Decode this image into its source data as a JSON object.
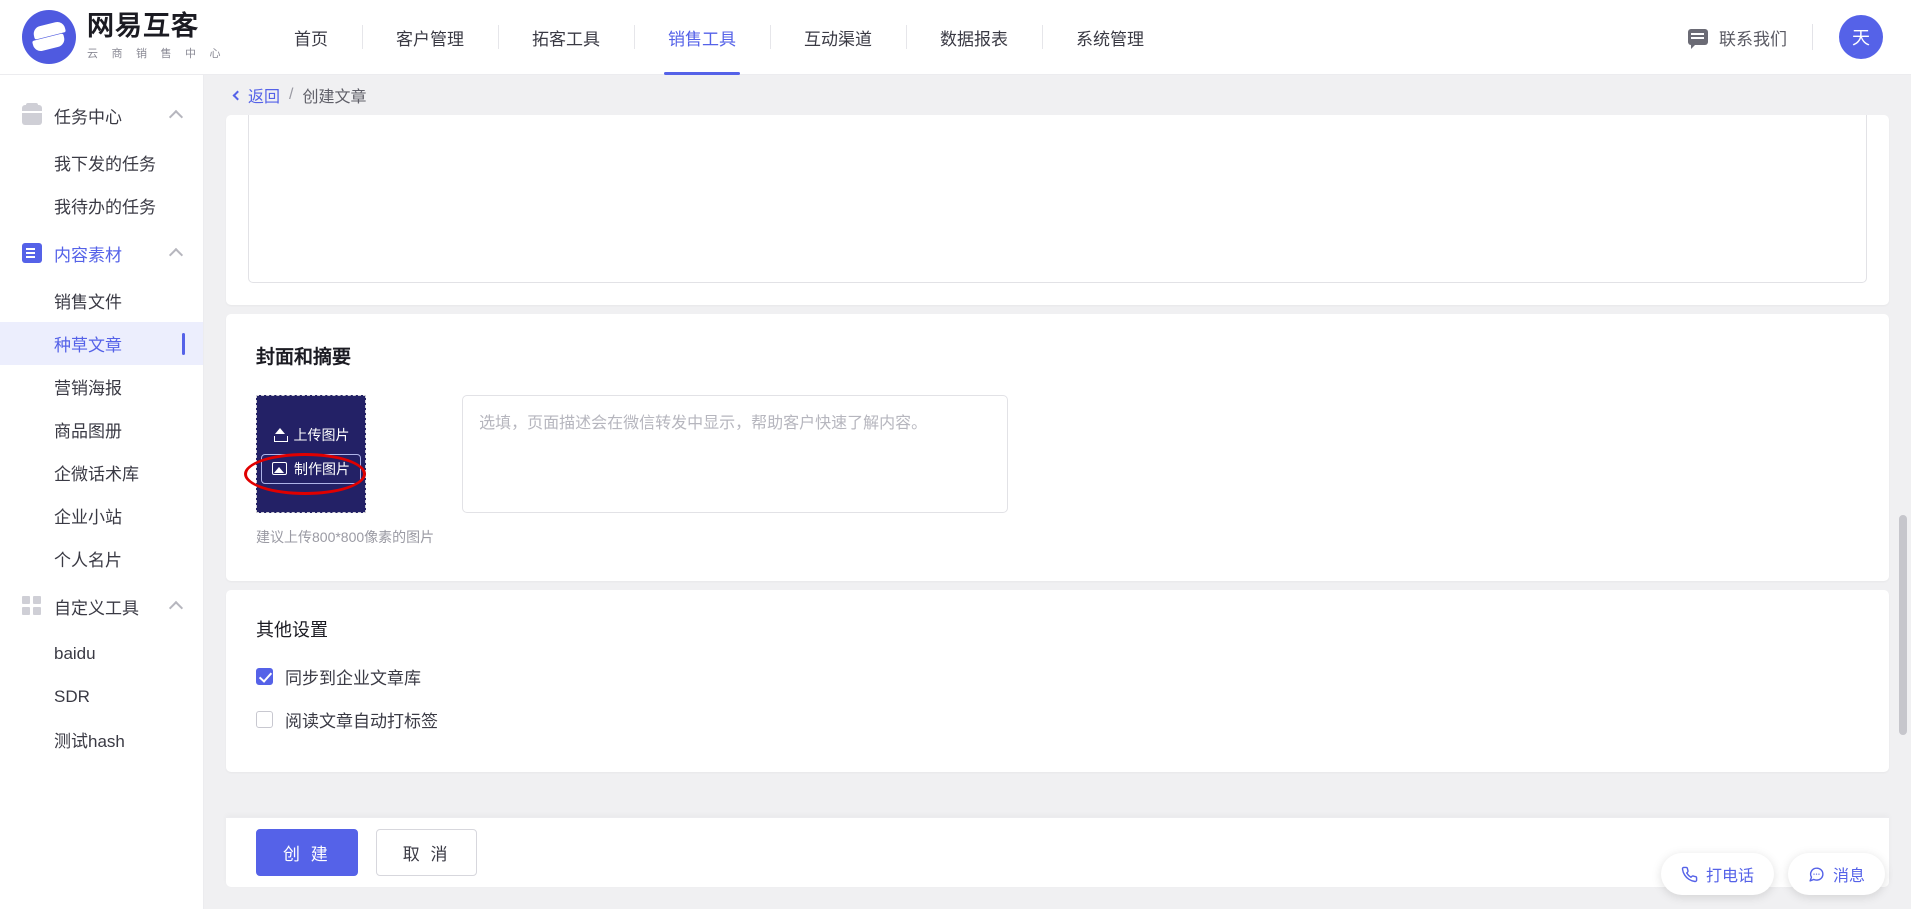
{
  "brand": {
    "name": "网易互客",
    "subtitle": "云 商 销 售 中 心",
    "logo_color": "#4f5ae0"
  },
  "topnav": {
    "items": [
      {
        "label": "首页",
        "active": false
      },
      {
        "label": "客户管理",
        "active": false
      },
      {
        "label": "拓客工具",
        "active": false
      },
      {
        "label": "销售工具",
        "active": true
      },
      {
        "label": "互动渠道",
        "active": false
      },
      {
        "label": "数据报表",
        "active": false
      },
      {
        "label": "系统管理",
        "active": false
      }
    ],
    "contact_label": "联系我们",
    "avatar_text": "天",
    "accent_color": "#5562e8"
  },
  "sidebar": {
    "groups": [
      {
        "label": "任务中心",
        "icon": "task-icon",
        "expanded": true,
        "items": [
          {
            "label": "我下发的任务",
            "active": false
          },
          {
            "label": "我待办的任务",
            "active": false
          }
        ]
      },
      {
        "label": "内容素材",
        "icon": "document-icon",
        "expanded": true,
        "accent": true,
        "items": [
          {
            "label": "销售文件",
            "active": false
          },
          {
            "label": "种草文章",
            "active": true
          },
          {
            "label": "营销海报",
            "active": false
          },
          {
            "label": "商品图册",
            "active": false
          },
          {
            "label": "企微话术库",
            "active": false
          },
          {
            "label": "企业小站",
            "active": false
          },
          {
            "label": "个人名片",
            "active": false
          }
        ]
      },
      {
        "label": "自定义工具",
        "icon": "grid-icon",
        "expanded": true,
        "items": [
          {
            "label": "baidu",
            "active": false
          },
          {
            "label": "SDR",
            "active": false
          },
          {
            "label": "测试hash",
            "active": false
          }
        ]
      }
    ]
  },
  "breadcrumb": {
    "back_label": "返回",
    "separator": "/",
    "current": "创建文章"
  },
  "main": {
    "cover_section": {
      "title": "封面和摘要",
      "upload_label": "上传图片",
      "make_image_label": "制作图片",
      "hint": "建议上传800*800像素的图片",
      "summary_placeholder": "选填，页面描述会在微信转发中显示，帮助客户快速了解内容。",
      "summary_value": "",
      "uploader_bg": "#232166",
      "annotation_color": "#e00000"
    },
    "other_section": {
      "title": "其他设置",
      "checkboxes": [
        {
          "label": "同步到企业文章库",
          "checked": true
        },
        {
          "label": "阅读文章自动打标签",
          "checked": false
        }
      ]
    },
    "footer": {
      "primary_label": "创 建",
      "cancel_label": "取 消"
    }
  },
  "float_buttons": [
    {
      "label": "打电话",
      "icon": "phone-icon"
    },
    {
      "label": "消息",
      "icon": "chat-bubble-icon"
    }
  ]
}
